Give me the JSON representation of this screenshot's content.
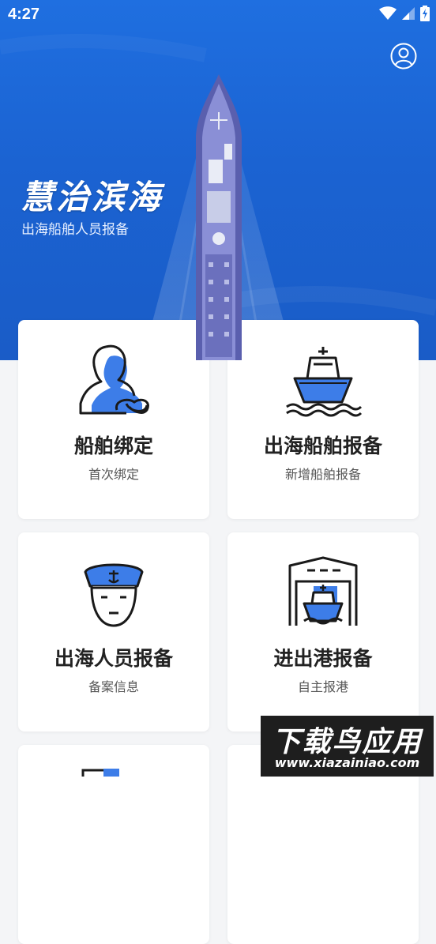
{
  "status_bar": {
    "time": "4:27",
    "icons": [
      "wifi-icon",
      "signal-icon",
      "battery-charging-icon"
    ]
  },
  "header": {
    "title": "慧治滨海",
    "subtitle": "出海船舶人员报备",
    "profile_icon": "user-profile-icon"
  },
  "cards": [
    {
      "title": "船舶绑定",
      "subtitle": "首次绑定",
      "icon": "person-bind-icon"
    },
    {
      "title": "出海船舶报备",
      "subtitle": "新增船舶报备",
      "icon": "ship-icon"
    },
    {
      "title": "出海人员报备",
      "subtitle": "备案信息",
      "icon": "sailor-icon"
    },
    {
      "title": "进出港报备",
      "subtitle": "自主报港",
      "icon": "harbor-icon"
    }
  ],
  "watermark": {
    "main": "下载鸟应用",
    "url": "www.xiazainiao.com"
  },
  "colors": {
    "brand_blue": "#1f6fe0",
    "icon_blue": "#3d7de8",
    "card_bg": "#ffffff",
    "page_bg": "#f4f5f7"
  }
}
